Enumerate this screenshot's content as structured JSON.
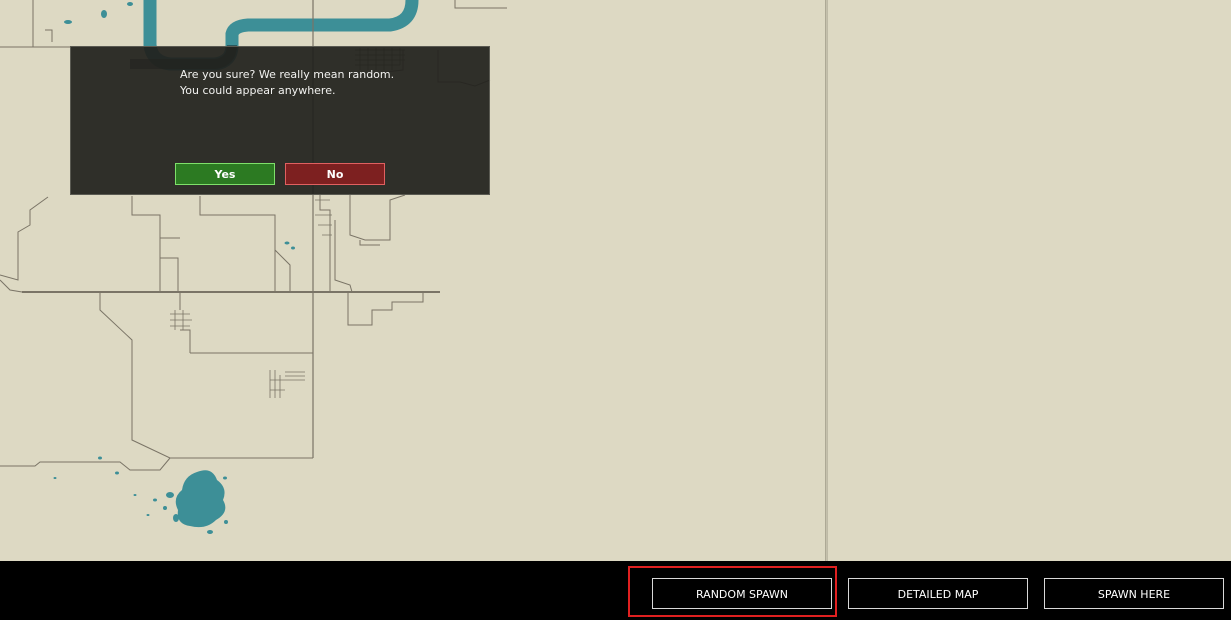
{
  "dialog": {
    "message_line1": "Are you sure? We really mean random.",
    "message_line2": "You could appear anywhere.",
    "yes_label": "Yes",
    "no_label": "No"
  },
  "bottom_bar": {
    "random_spawn_label": "RANDOM SPAWN",
    "detailed_map_label": "DETAILED MAP",
    "spawn_here_label": "SPAWN HERE"
  },
  "colors": {
    "map_background": "#ddd9c3",
    "river": "#3d8f97",
    "road": "#7a7466",
    "dialog_background": "#21211d",
    "yes_button": "#2c7a22",
    "no_button": "#7d2020",
    "highlight": "#e02020"
  }
}
